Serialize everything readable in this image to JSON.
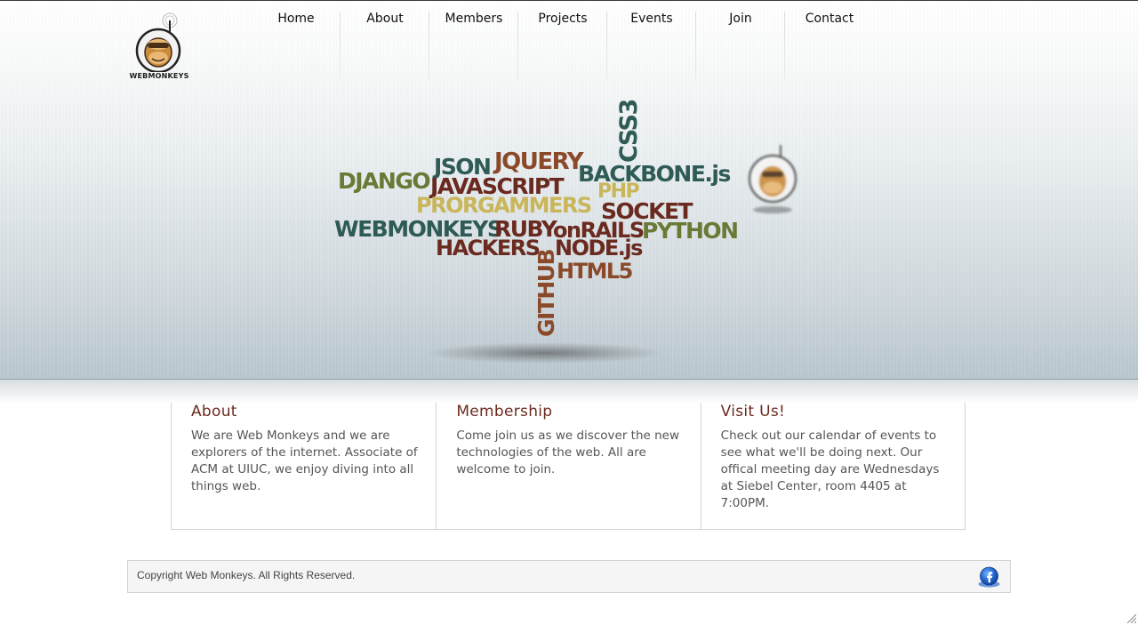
{
  "brand": {
    "logo_text": "WEBMONKEYS"
  },
  "nav": {
    "items": [
      {
        "label": "Home"
      },
      {
        "label": "About"
      },
      {
        "label": "Members"
      },
      {
        "label": "Projects"
      },
      {
        "label": "Events"
      },
      {
        "label": "Join"
      },
      {
        "label": "Contact"
      }
    ]
  },
  "hero": {
    "word_cloud": [
      {
        "text": "CSS3",
        "color": "#2f5b57"
      },
      {
        "text": "JSON",
        "color": "#2f5b57"
      },
      {
        "text": "JQUERY",
        "color": "#8a4a2a"
      },
      {
        "text": "BACKBONE.js",
        "color": "#2f5b57"
      },
      {
        "text": "DJANGO",
        "color": "#6a7a36"
      },
      {
        "text": "JAVASCRIPT",
        "color": "#6b2a1f"
      },
      {
        "text": "PHP",
        "color": "#c9b65a"
      },
      {
        "text": "PRORGAMMERS",
        "color": "#c9b65a"
      },
      {
        "text": "SOCKET",
        "color": "#6b2a1f"
      },
      {
        "text": "WEBMONKEYS",
        "color": "#2f5b57"
      },
      {
        "text": "RUBY",
        "color": "#6b2a1f"
      },
      {
        "text": "onRAILS",
        "color": "#6b2a1f"
      },
      {
        "text": "PYTHON",
        "color": "#6a7a36"
      },
      {
        "text": "HACKERS",
        "color": "#6b2a1f"
      },
      {
        "text": "NODE.js",
        "color": "#6b2a1f"
      },
      {
        "text": "GITHUB",
        "color": "#8a4a2a"
      },
      {
        "text": "HTML5",
        "color": "#8a4a2a"
      }
    ]
  },
  "columns": [
    {
      "title": "About",
      "body": "We are Web Monkeys and we are explorers of the internet. Associate of ACM at UIUC, we enjoy diving into all things web."
    },
    {
      "title": "Membership",
      "body": "Come join us as we discover the new technologies of the web. All are welcome to join."
    },
    {
      "title": "Visit Us!",
      "body": "Check out our calendar of events to see what we'll be doing next. Our offical meeting day are Wednesdays at Siebel Center, room 4405 at 7:00PM."
    }
  ],
  "footer": {
    "copyright": "Copyright Web Monkeys. All Rights Reserved.",
    "social_icon": "facebook-icon"
  },
  "colors": {
    "heading": "#6b2a1f",
    "teal": "#2f5b57",
    "olive": "#6a7a36",
    "gold": "#c9b65a",
    "maroon": "#6b2a1f",
    "brown": "#8a4a2a"
  }
}
